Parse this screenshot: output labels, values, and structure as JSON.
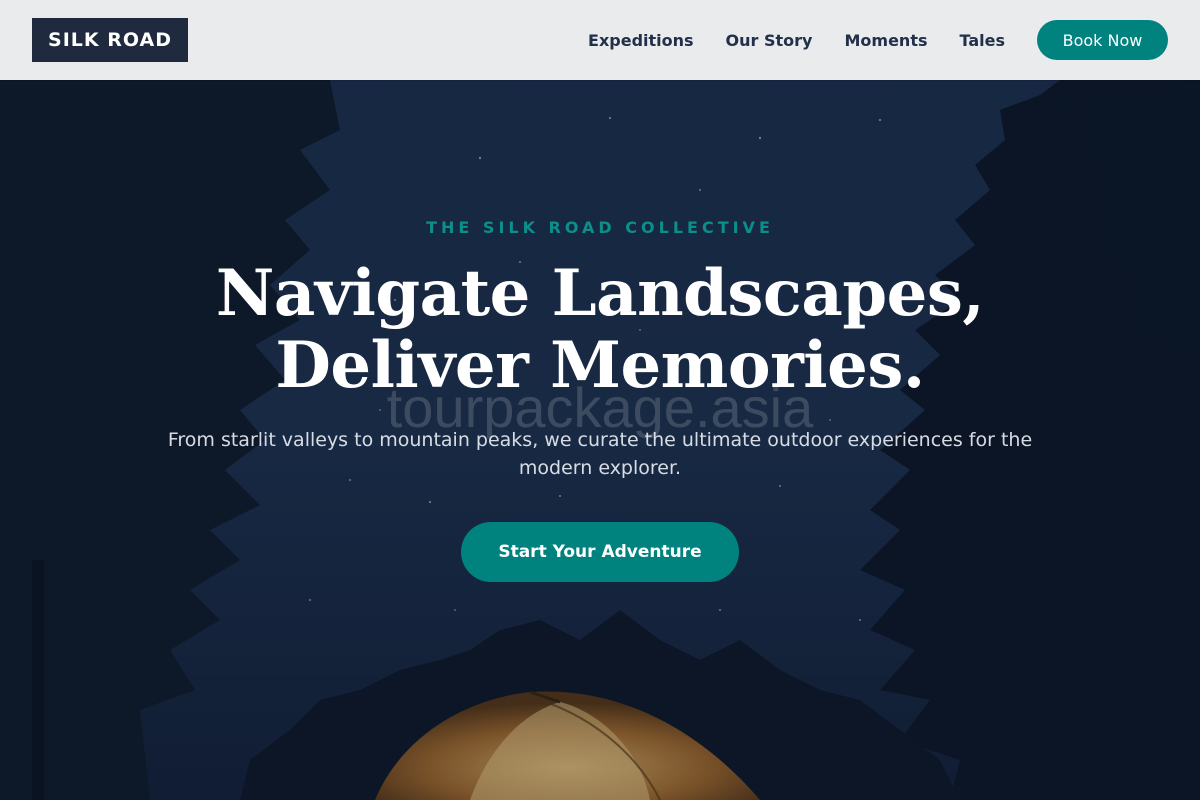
{
  "header": {
    "logo_text": "SILK ROAD",
    "nav": [
      {
        "label": "Expeditions"
      },
      {
        "label": "Our Story"
      },
      {
        "label": "Moments"
      },
      {
        "label": "Tales"
      }
    ],
    "cta_label": "Book Now"
  },
  "hero": {
    "eyebrow": "THE SILK ROAD COLLECTIVE",
    "headline_line1": "Navigate Landscapes,",
    "headline_line2": "Deliver Memories.",
    "watermark": "tourpackage.asia",
    "subtitle": "From starlit valleys to mountain peaks, we curate the ultimate outdoor experiences for the modern explorer.",
    "cta_label": "Start Your Adventure"
  },
  "colors": {
    "accent": "#00827f",
    "header_bg": "#e9ebed",
    "logo_bg": "#1f2a3e",
    "night_sky": "#1a2d4c"
  }
}
